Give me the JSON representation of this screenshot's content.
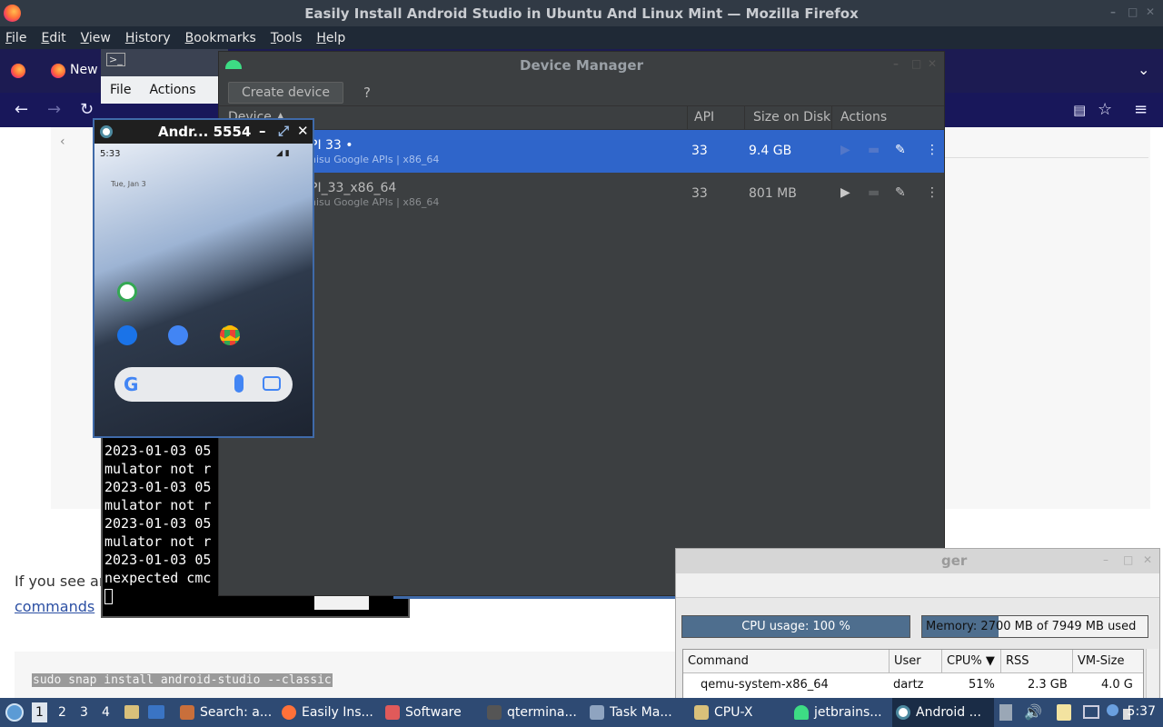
{
  "firefox": {
    "window_title": "Easily Install Android Studio in Ubuntu And Linux Mint — Mozilla Firefox",
    "menu": [
      "File",
      "Edit",
      "View",
      "History",
      "Bookmarks",
      "Tools",
      "Help"
    ],
    "tab_label": "New"
  },
  "article": {
    "text_partial": "If you see ar",
    "link_partial": "commands",
    "code_line": "sudo snap install android-studio --classic"
  },
  "terminal": {
    "menu": [
      "File",
      "Actions"
    ],
    "output": "2023-01-03 05\nmulator not r\n2023-01-03 05\nmulator not r\n2023-01-03 05\nmulator not r\n2023-01-03 05\nnexpected cmc"
  },
  "device_manager": {
    "title": "Device Manager",
    "create_button": "Create device",
    "help": "?",
    "columns": {
      "device": "Device ▲",
      "api": "API",
      "size": "Size on Disk",
      "actions": "Actions"
    },
    "devices": [
      {
        "name": "PI 33 •",
        "sub": "nisu Google APIs | x86_64",
        "api": "33",
        "size": "9.4 GB",
        "selected": true
      },
      {
        "name": "PI_33_x86_64",
        "sub": "nisu Google APIs | x86_64",
        "api": "33",
        "size": "801 MB",
        "selected": false
      }
    ]
  },
  "emulator": {
    "title": "Andr... 5554",
    "time": "5:33",
    "date": "Tue, Jan 3",
    "google_letter": "G"
  },
  "task_manager": {
    "title_partial": "ger",
    "cpu_label": "CPU usage: 100 %",
    "cpu_fraction": 1.0,
    "mem_label": "Memory: 2700 MB of 7949 MB used",
    "mem_fraction": 0.34,
    "columns": [
      "Command",
      "User",
      "CPU% ▼",
      "RSS",
      "VM-Size"
    ],
    "rows": [
      {
        "command": "qemu-system-x86_64",
        "user": "dartz",
        "cpu": "51%",
        "rss": "2.3 GB",
        "vm": "4.0 G"
      }
    ]
  },
  "taskbar": {
    "workspaces": [
      "1",
      "2",
      "3",
      "4"
    ],
    "items": [
      {
        "label": "Search: a...",
        "icon": "search-window-icon",
        "color": "#c96f3b"
      },
      {
        "label": "Easily Ins...",
        "icon": "firefox-icon",
        "color": "#ff7139"
      },
      {
        "label": "Software",
        "icon": "software-icon",
        "color": "#e05a5a"
      },
      {
        "label": "qtermina...",
        "icon": "terminal-icon",
        "color": "#555555"
      },
      {
        "label": "Task Ma...",
        "icon": "task-manager-icon",
        "color": "#8fa4c0"
      },
      {
        "label": "CPU-X",
        "icon": "cpux-icon",
        "color": "#d9c07a"
      },
      {
        "label": "jetbrains...",
        "icon": "android-icon",
        "color": "#3ddc84"
      },
      {
        "label": "Android ...",
        "icon": "emulator-icon",
        "color": "#4d8aa0"
      }
    ],
    "clock": "5:37"
  }
}
